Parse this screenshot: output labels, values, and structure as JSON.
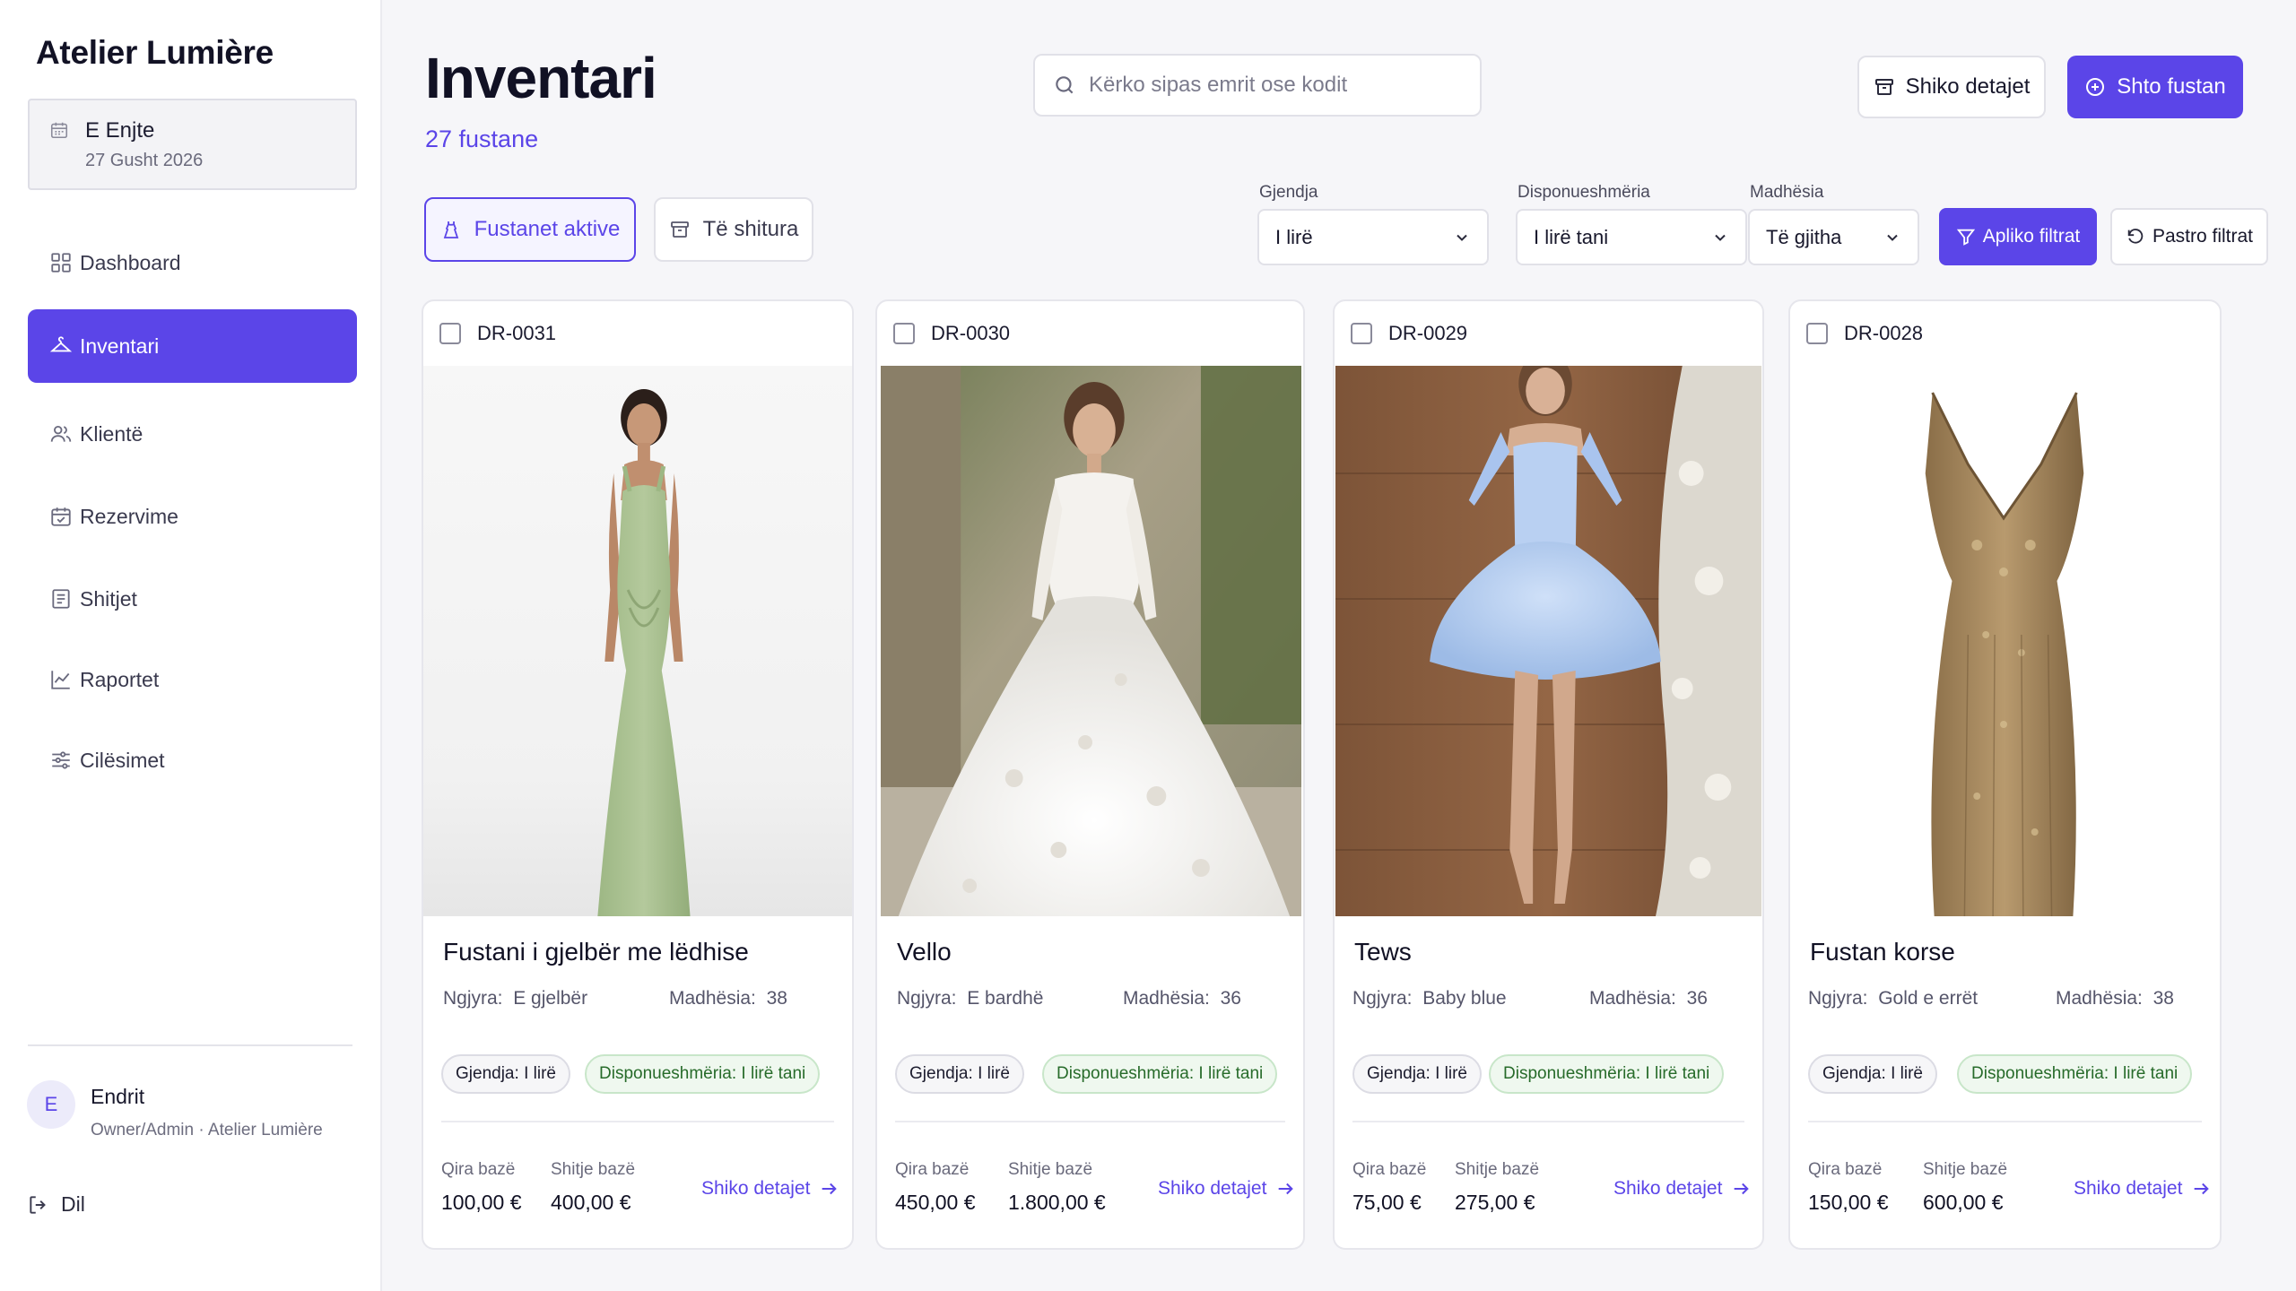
{
  "sidebar": {
    "brand": "Atelier Lumière",
    "date": {
      "day": "E Enjte",
      "date": "27 Gusht 2026"
    },
    "nav": [
      {
        "label": "Dashboard",
        "icon": "grid-icon"
      },
      {
        "label": "Inventari",
        "icon": "hanger-icon",
        "active": true
      },
      {
        "label": "Klientë",
        "icon": "users-icon"
      },
      {
        "label": "Rezervime",
        "icon": "calendar-check-icon"
      },
      {
        "label": "Shitjet",
        "icon": "receipt-icon"
      },
      {
        "label": "Raportet",
        "icon": "chart-line-icon"
      },
      {
        "label": "Cilësimet",
        "icon": "sliders-icon"
      }
    ],
    "user": {
      "initial": "E",
      "name": "Endrit",
      "role": "Owner/Admin · Atelier Lumière"
    },
    "logout": "Dil"
  },
  "header": {
    "title": "Inventari",
    "count": "27 fustane",
    "search_placeholder": "Kërko sipas emrit ose kodit",
    "view_details": "Shiko detajet",
    "add_dress": "Shto fustan"
  },
  "tabs": [
    {
      "label": "Fustanet aktive",
      "active": true
    },
    {
      "label": "Të shitura",
      "active": false
    }
  ],
  "filters": {
    "condition": {
      "label": "Gjendja",
      "value": "I lirë"
    },
    "availability": {
      "label": "Disponueshmëria",
      "value": "I lirë tani"
    },
    "size": {
      "label": "Madhësia",
      "value": "Të gjitha"
    },
    "apply": "Apliko filtrat",
    "clear": "Pastro filtrat"
  },
  "labels": {
    "color": "Ngjyra:",
    "size": "Madhësia:",
    "state": "Gjendja:",
    "availability": "Disponueshmëria:",
    "base_rent": "Qira bazë",
    "base_sale": "Shitje bazë",
    "details": "Shiko detajet"
  },
  "dresses": [
    {
      "code": "DR-0031",
      "name": "Fustani i gjelbër me lëdhise",
      "color": "E gjelbër",
      "size": "38",
      "state": "I lirë",
      "availability": "I lirë tani",
      "rent": "100,00 €",
      "sale": "400,00 €"
    },
    {
      "code": "DR-0030",
      "name": "Vello",
      "color": "E bardhë",
      "size": "36",
      "state": "I lirë",
      "availability": "I lirë tani",
      "rent": "450,00 €",
      "sale": "1.800,00 €"
    },
    {
      "code": "DR-0029",
      "name": "Tews",
      "color": "Baby blue",
      "size": "36",
      "state": "I lirë",
      "availability": "I lirë tani",
      "rent": "75,00 €",
      "sale": "275,00 €"
    },
    {
      "code": "DR-0028",
      "name": "Fustan korse",
      "color": "Gold e errët",
      "size": "38",
      "state": "I lirë",
      "availability": "I lirë tani",
      "rent": "150,00 €",
      "sale": "600,00 €"
    }
  ],
  "colors": {
    "accent": "#5b45e8",
    "available_text": "#276b2a"
  }
}
